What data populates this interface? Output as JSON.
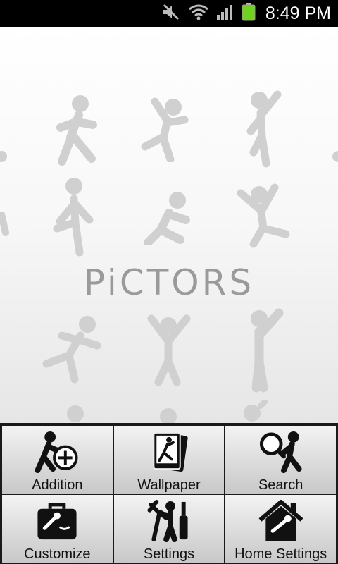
{
  "status_bar": {
    "time": "8:49 PM",
    "icons": [
      "mute-icon",
      "wifi-icon",
      "signal-icon",
      "battery-icon"
    ],
    "battery_color": "#6fd21f"
  },
  "wallpaper": {
    "logo_text": "PiCTORS",
    "figure_color": "#d0d0d0"
  },
  "menu": {
    "items": [
      {
        "label": "Addition",
        "icon": "add-person-icon"
      },
      {
        "label": "Wallpaper",
        "icon": "wallpaper-icon"
      },
      {
        "label": "Search",
        "icon": "search-person-icon"
      },
      {
        "label": "Customize",
        "icon": "toolbox-icon"
      },
      {
        "label": "Settings",
        "icon": "tools-icon"
      },
      {
        "label": "Home Settings",
        "icon": "home-tools-icon"
      }
    ]
  }
}
